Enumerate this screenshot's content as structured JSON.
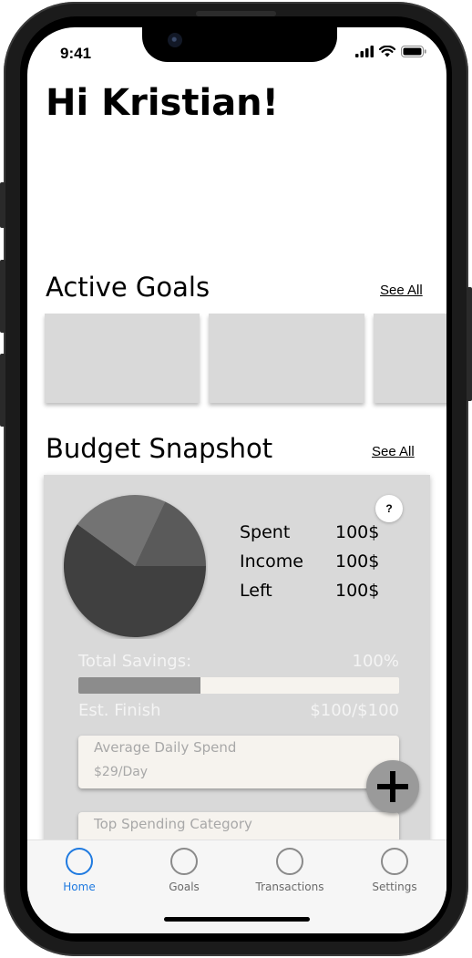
{
  "status_bar": {
    "time": "9:41"
  },
  "greeting": "Hi Kristian!",
  "active_goals": {
    "title": "Active Goals",
    "see_all": "See All"
  },
  "budget_snapshot": {
    "title": "Budget Snapshot",
    "see_all": "See All",
    "help_label": "?",
    "stats": [
      {
        "label": "Spent",
        "value": "100$"
      },
      {
        "label": "Income",
        "value": "100$"
      },
      {
        "label": "Left",
        "value": "100$"
      }
    ],
    "pie_slices": [
      {
        "fraction": 0.6,
        "color": "#404040"
      },
      {
        "fraction": 0.22,
        "color": "#737373"
      },
      {
        "fraction": 0.18,
        "color": "#5a5a5a"
      }
    ],
    "total_savings_label": "Total Savings:",
    "total_savings_value": "100%",
    "savings_progress": 0.38,
    "est_finish_label": "Est. Finish",
    "est_finish_value": "$100/$100",
    "avg_daily_spend": {
      "title": "Average Daily Spend",
      "value": "$29/Day"
    },
    "top_spending_category": {
      "title": "Top Spending Category"
    }
  },
  "tabs": [
    {
      "label": "Home",
      "active": true
    },
    {
      "label": "Goals",
      "active": false
    },
    {
      "label": "Transactions",
      "active": false
    },
    {
      "label": "Settings",
      "active": false
    }
  ],
  "colors": {
    "accent": "#1f7ae0",
    "card_gray": "#d9d9d9"
  }
}
